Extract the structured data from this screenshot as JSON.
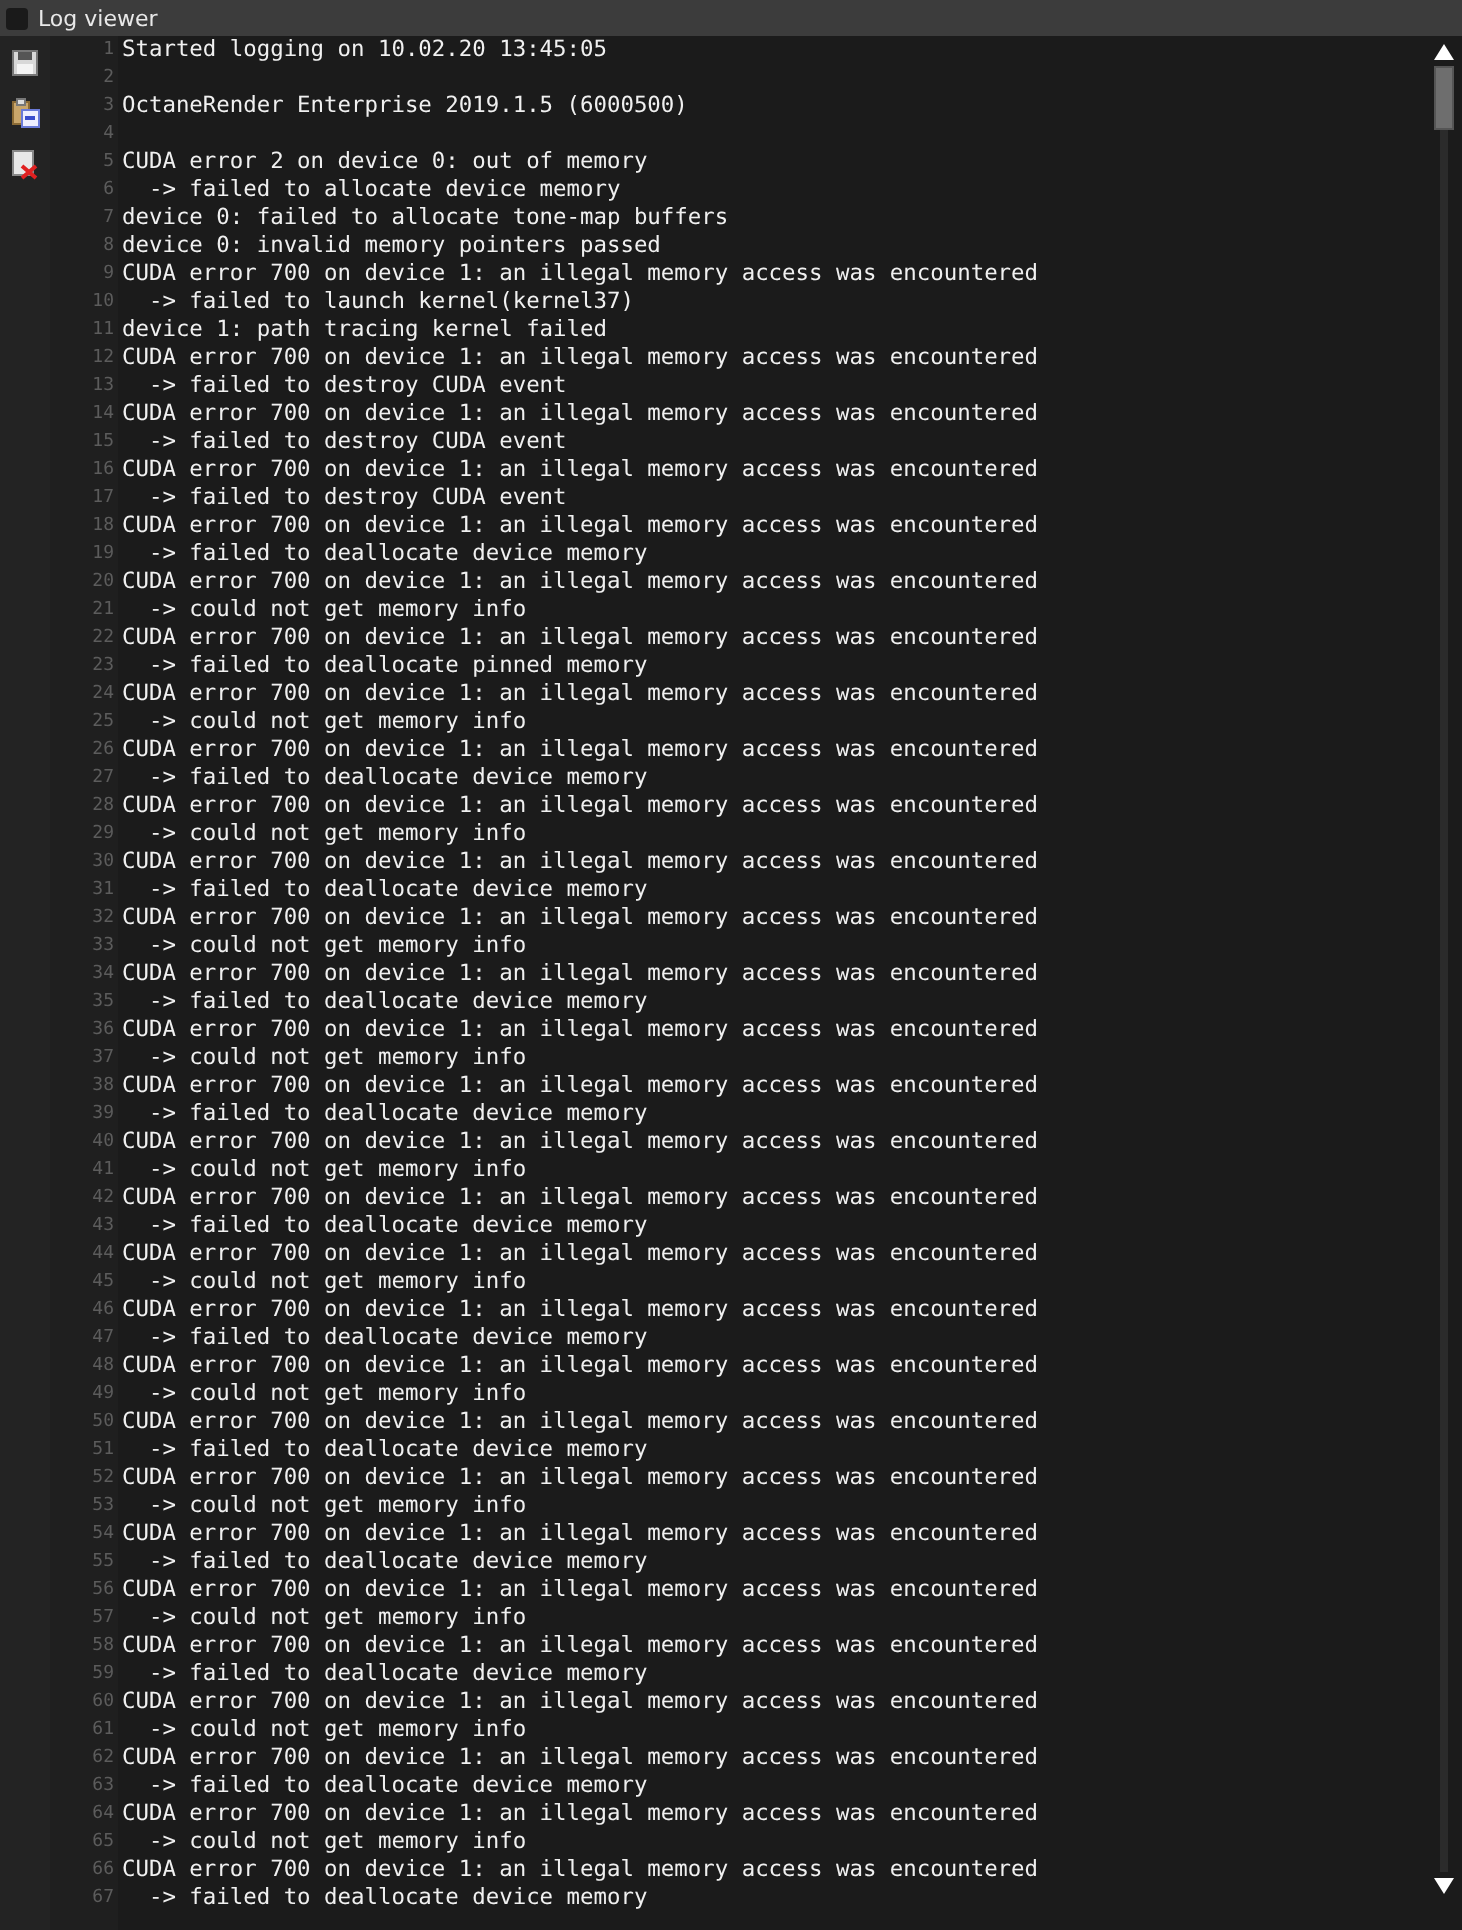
{
  "window": {
    "title": "Log viewer"
  },
  "toolbar": [
    {
      "kind": "save"
    },
    {
      "kind": "paste"
    },
    {
      "kind": "clear"
    }
  ],
  "lines": [
    {
      "number": "1",
      "text": "Started logging on 10.02.20 13:45:05"
    },
    {
      "number": "2"
    },
    {
      "number": "3",
      "text": "OctaneRender Enterprise 2019.1.5 (6000500)"
    },
    {
      "number": "4"
    },
    {
      "number": "5",
      "text": "CUDA error 2 on device 0: out of memory"
    },
    {
      "number": "6",
      "text": "  -> failed to allocate device memory"
    },
    {
      "number": "7",
      "text": "device 0: failed to allocate tone-map buffers"
    },
    {
      "number": "8",
      "text": "device 0: invalid memory pointers passed"
    },
    {
      "number": "9",
      "text": "CUDA error 700 on device 1: an illegal memory access was encountered"
    },
    {
      "number": "10",
      "text": "  -> failed to launch kernel(kernel37)"
    },
    {
      "number": "11",
      "text": "device 1: path tracing kernel failed"
    },
    {
      "number": "12",
      "text": "CUDA error 700 on device 1: an illegal memory access was encountered"
    },
    {
      "number": "13",
      "text": "  -> failed to destroy CUDA event"
    },
    {
      "number": "14",
      "text": "CUDA error 700 on device 1: an illegal memory access was encountered"
    },
    {
      "number": "15",
      "text": "  -> failed to destroy CUDA event"
    },
    {
      "number": "16",
      "text": "CUDA error 700 on device 1: an illegal memory access was encountered"
    },
    {
      "number": "17",
      "text": "  -> failed to destroy CUDA event"
    },
    {
      "number": "18",
      "text": "CUDA error 700 on device 1: an illegal memory access was encountered"
    },
    {
      "number": "19",
      "text": "  -> failed to deallocate device memory"
    },
    {
      "number": "20",
      "text": "CUDA error 700 on device 1: an illegal memory access was encountered"
    },
    {
      "number": "21",
      "text": "  -> could not get memory info"
    },
    {
      "number": "22",
      "text": "CUDA error 700 on device 1: an illegal memory access was encountered"
    },
    {
      "number": "23",
      "text": "  -> failed to deallocate pinned memory"
    },
    {
      "number": "24",
      "text": "CUDA error 700 on device 1: an illegal memory access was encountered"
    },
    {
      "number": "25",
      "text": "  -> could not get memory info"
    },
    {
      "number": "26",
      "text": "CUDA error 700 on device 1: an illegal memory access was encountered"
    },
    {
      "number": "27",
      "text": "  -> failed to deallocate device memory"
    },
    {
      "number": "28",
      "text": "CUDA error 700 on device 1: an illegal memory access was encountered"
    },
    {
      "number": "29",
      "text": "  -> could not get memory info"
    },
    {
      "number": "30",
      "text": "CUDA error 700 on device 1: an illegal memory access was encountered"
    },
    {
      "number": "31",
      "text": "  -> failed to deallocate device memory"
    },
    {
      "number": "32",
      "text": "CUDA error 700 on device 1: an illegal memory access was encountered"
    },
    {
      "number": "33",
      "text": "  -> could not get memory info"
    },
    {
      "number": "34",
      "text": "CUDA error 700 on device 1: an illegal memory access was encountered"
    },
    {
      "number": "35",
      "text": "  -> failed to deallocate device memory"
    },
    {
      "number": "36",
      "text": "CUDA error 700 on device 1: an illegal memory access was encountered"
    },
    {
      "number": "37",
      "text": "  -> could not get memory info"
    },
    {
      "number": "38",
      "text": "CUDA error 700 on device 1: an illegal memory access was encountered"
    },
    {
      "number": "39",
      "text": "  -> failed to deallocate device memory"
    },
    {
      "number": "40",
      "text": "CUDA error 700 on device 1: an illegal memory access was encountered"
    },
    {
      "number": "41",
      "text": "  -> could not get memory info"
    },
    {
      "number": "42",
      "text": "CUDA error 700 on device 1: an illegal memory access was encountered"
    },
    {
      "number": "43",
      "text": "  -> failed to deallocate device memory"
    },
    {
      "number": "44",
      "text": "CUDA error 700 on device 1: an illegal memory access was encountered"
    },
    {
      "number": "45",
      "text": "  -> could not get memory info"
    },
    {
      "number": "46",
      "text": "CUDA error 700 on device 1: an illegal memory access was encountered"
    },
    {
      "number": "47",
      "text": "  -> failed to deallocate device memory"
    },
    {
      "number": "48",
      "text": "CUDA error 700 on device 1: an illegal memory access was encountered"
    },
    {
      "number": "49",
      "text": "  -> could not get memory info"
    },
    {
      "number": "50",
      "text": "CUDA error 700 on device 1: an illegal memory access was encountered"
    },
    {
      "number": "51",
      "text": "  -> failed to deallocate device memory"
    },
    {
      "number": "52",
      "text": "CUDA error 700 on device 1: an illegal memory access was encountered"
    },
    {
      "number": "53",
      "text": "  -> could not get memory info"
    },
    {
      "number": "54",
      "text": "CUDA error 700 on device 1: an illegal memory access was encountered"
    },
    {
      "number": "55",
      "text": "  -> failed to deallocate device memory"
    },
    {
      "number": "56",
      "text": "CUDA error 700 on device 1: an illegal memory access was encountered"
    },
    {
      "number": "57",
      "text": "  -> could not get memory info"
    },
    {
      "number": "58",
      "text": "CUDA error 700 on device 1: an illegal memory access was encountered"
    },
    {
      "number": "59",
      "text": "  -> failed to deallocate device memory"
    },
    {
      "number": "60",
      "text": "CUDA error 700 on device 1: an illegal memory access was encountered"
    },
    {
      "number": "61",
      "text": "  -> could not get memory info"
    },
    {
      "number": "62",
      "text": "CUDA error 700 on device 1: an illegal memory access was encountered"
    },
    {
      "number": "63",
      "text": "  -> failed to deallocate device memory"
    },
    {
      "number": "64",
      "text": "CUDA error 700 on device 1: an illegal memory access was encountered"
    },
    {
      "number": "65",
      "text": "  -> could not get memory info"
    },
    {
      "number": "66",
      "text": "CUDA error 700 on device 1: an illegal memory access was encountered"
    },
    {
      "number": "67",
      "text": "  -> failed to deallocate device memory"
    }
  ]
}
